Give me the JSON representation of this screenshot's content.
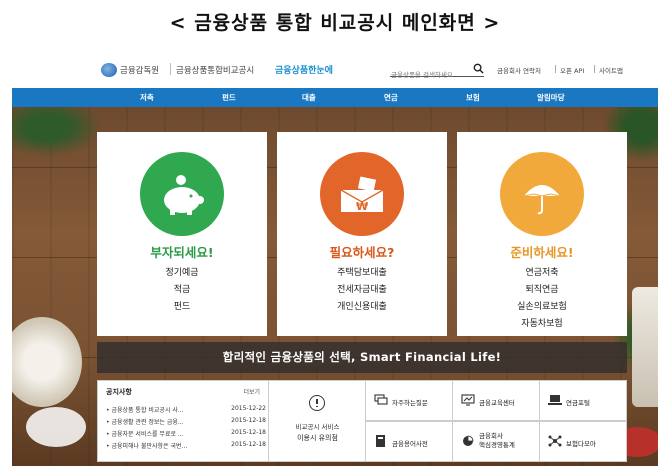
{
  "caption": "< 금융상품 통합 비교공시 메인화면 >",
  "header": {
    "org": "금융감독원",
    "site": "금융상품통합비교공시",
    "brand": "금융상품한눈에",
    "search_placeholder": "금융상품을 검색하세요",
    "utils": [
      "금융회사 연락처",
      "오픈 API",
      "사이트맵"
    ]
  },
  "nav": [
    "저축",
    "펀드",
    "대출",
    "연금",
    "보험",
    "알림마당"
  ],
  "cards": [
    {
      "title": "부자되세요!",
      "color": "#2fa84f",
      "title_color": "#2b9a46",
      "items": [
        "정기예금",
        "적금",
        "펀드"
      ]
    },
    {
      "title": "필요하세요?",
      "color": "#e2662a",
      "title_color": "#d9581c",
      "items": [
        "주택담보대출",
        "전세자금대출",
        "개인신용대출"
      ]
    },
    {
      "title": "준비하세요!",
      "color": "#f2a93b",
      "title_color": "#e8962a",
      "items": [
        "연금저축",
        "퇴직연금",
        "실손의료보험",
        "자동차보험"
      ]
    }
  ],
  "banner": "합리적인 금융상품의 선택, Smart Financial Life!",
  "notice": {
    "title": "공지사항",
    "more": "더보기",
    "rows": [
      {
        "text": "• 금융상품 통합 비교공시 사...",
        "date": "2015-12-22"
      },
      {
        "text": "• 금융생활 관련 정보는 금융...",
        "date": "2015-12-18"
      },
      {
        "text": "• 금융자문 서비스를 무료로 ...",
        "date": "2015-12-18"
      },
      {
        "text": "• 금융피해나 불만사항은 국번...",
        "date": "2015-12-18"
      }
    ]
  },
  "service": {
    "line1": "비교공시 서비스",
    "line2": "이용시 유의점"
  },
  "tiles": [
    {
      "label": "자주하는질문",
      "icon": "chat-icon"
    },
    {
      "label": "금융교육센터",
      "icon": "monitor-chart-icon"
    },
    {
      "label": "연금포털",
      "icon": "laptop-icon"
    },
    {
      "label": "금융용어사전",
      "icon": "book-icon"
    },
    {
      "label": "금융회사 핵심경영통계",
      "line1": "금융회사",
      "line2": "핵심경영통계",
      "icon": "pie-chart-icon"
    },
    {
      "label": "보험다모아",
      "icon": "network-icon"
    }
  ]
}
